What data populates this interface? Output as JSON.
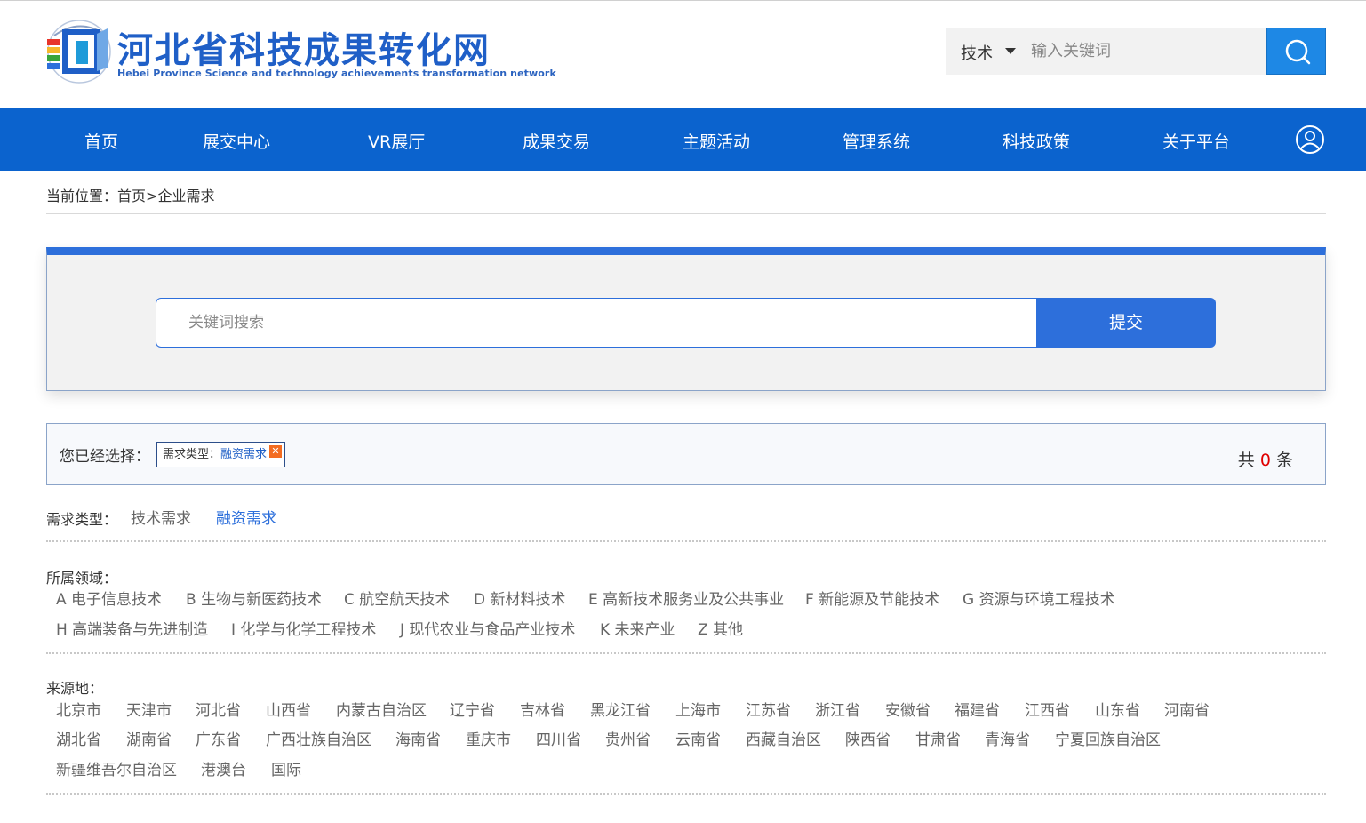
{
  "header": {
    "logo_title": "河北省科技成果转化网",
    "logo_subtitle": "Hebei Province Science and technology achievements transformation network",
    "search_category": "技术",
    "search_placeholder": "输入关键词"
  },
  "nav": {
    "items": [
      "首页",
      "展交中心",
      "VR展厅",
      "成果交易",
      "主题活动",
      "管理系统",
      "科技政策",
      "关于平台"
    ]
  },
  "breadcrumb": {
    "prefix": "当前位置：",
    "home": "首页",
    "separator": ">",
    "current": "企业需求"
  },
  "search": {
    "placeholder": "关键词搜索",
    "submit_label": "提交"
  },
  "selection": {
    "label": "您已经选择：",
    "tag_key": "需求类型：",
    "tag_value": "融资需求",
    "tag_close": "✕",
    "count_prefix": "共",
    "count_value": "0",
    "count_suffix": "条"
  },
  "filters": {
    "demand_type": {
      "label": "需求类型：",
      "options": [
        "技术需求",
        "融资需求"
      ],
      "selected": "融资需求"
    },
    "field": {
      "label": "所属领域：",
      "options": [
        "A 电子信息技术",
        "B 生物与新医药技术",
        "C 航空航天技术",
        "D 新材料技术",
        "E 高新技术服务业及公共事业",
        "F 新能源及节能技术",
        "G 资源与环境工程技术",
        "H 高端装备与先进制造",
        "I 化学与化学工程技术",
        "J 现代农业与食品产业技术",
        "K 未来产业",
        "Z 其他"
      ]
    },
    "source": {
      "label": "来源地：",
      "options": [
        "北京市",
        "天津市",
        "河北省",
        "山西省",
        "内蒙古自治区",
        "辽宁省",
        "吉林省",
        "黑龙江省",
        "上海市",
        "江苏省",
        "浙江省",
        "安徽省",
        "福建省",
        "江西省",
        "山东省",
        "河南省",
        "湖北省",
        "湖南省",
        "广东省",
        "广西壮族自治区",
        "海南省",
        "重庆市",
        "四川省",
        "贵州省",
        "云南省",
        "西藏自治区",
        "陕西省",
        "甘肃省",
        "青海省",
        "宁夏回族自治区",
        "新疆维吾尔自治区",
        "港澳台",
        "国际"
      ]
    }
  },
  "colors": {
    "nav_bg": "#0b63ce",
    "accent": "#2d6fdb",
    "logo_text": "#1f5fc7",
    "count_red": "#e00000"
  }
}
